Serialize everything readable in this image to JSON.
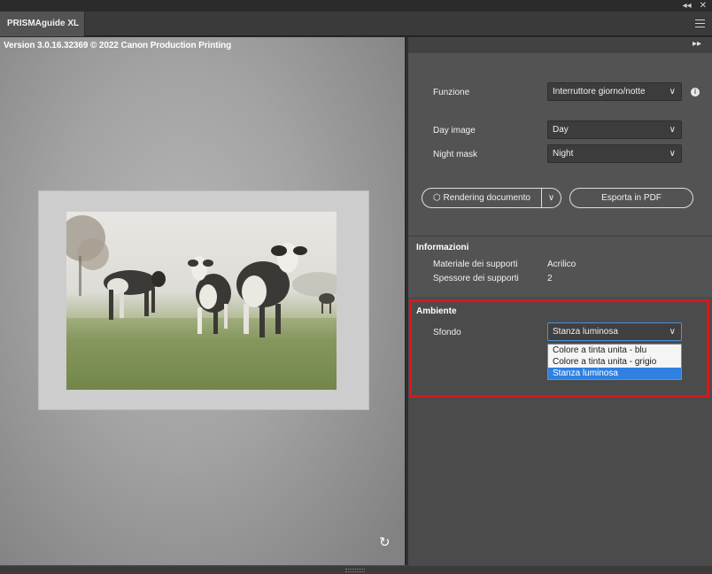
{
  "window": {
    "tab_title": "PRISMAguide XL",
    "collapse_glyph": "◂◂",
    "close_glyph": "✕"
  },
  "preview": {
    "version_text": "Version 3.0.16.32369 © 2022 Canon Production Printing",
    "refresh_glyph": "↻"
  },
  "panel": {
    "expand_glyph": "▸▸",
    "funzione": {
      "label": "Funzione",
      "value": "Interruttore giorno/notte",
      "info_glyph": "i"
    },
    "day_image": {
      "label": "Day image",
      "value": "Day"
    },
    "night_mask": {
      "label": "Night mask",
      "value": "Night"
    },
    "rendering_button": "Rendering documento",
    "export_button": "Esporta in PDF",
    "info_section": {
      "title": "Informazioni",
      "rows": [
        {
          "label": "Materiale dei supporti",
          "value": "Acrilico"
        },
        {
          "label": "Spessore dei supporti",
          "value": "2"
        }
      ]
    },
    "ambiente": {
      "title": "Ambiente",
      "sfondo_label": "Sfondo",
      "sfondo_value": "Stanza luminosa",
      "options": [
        "Colore a tinta unita - blu",
        "Colore a tinta unita - grigio",
        "Stanza luminosa"
      ],
      "selected_index": 2
    }
  },
  "colors": {
    "accent_highlight": "#e0141b",
    "selection_blue": "#2f80e0",
    "panel_bg": "#535353"
  }
}
